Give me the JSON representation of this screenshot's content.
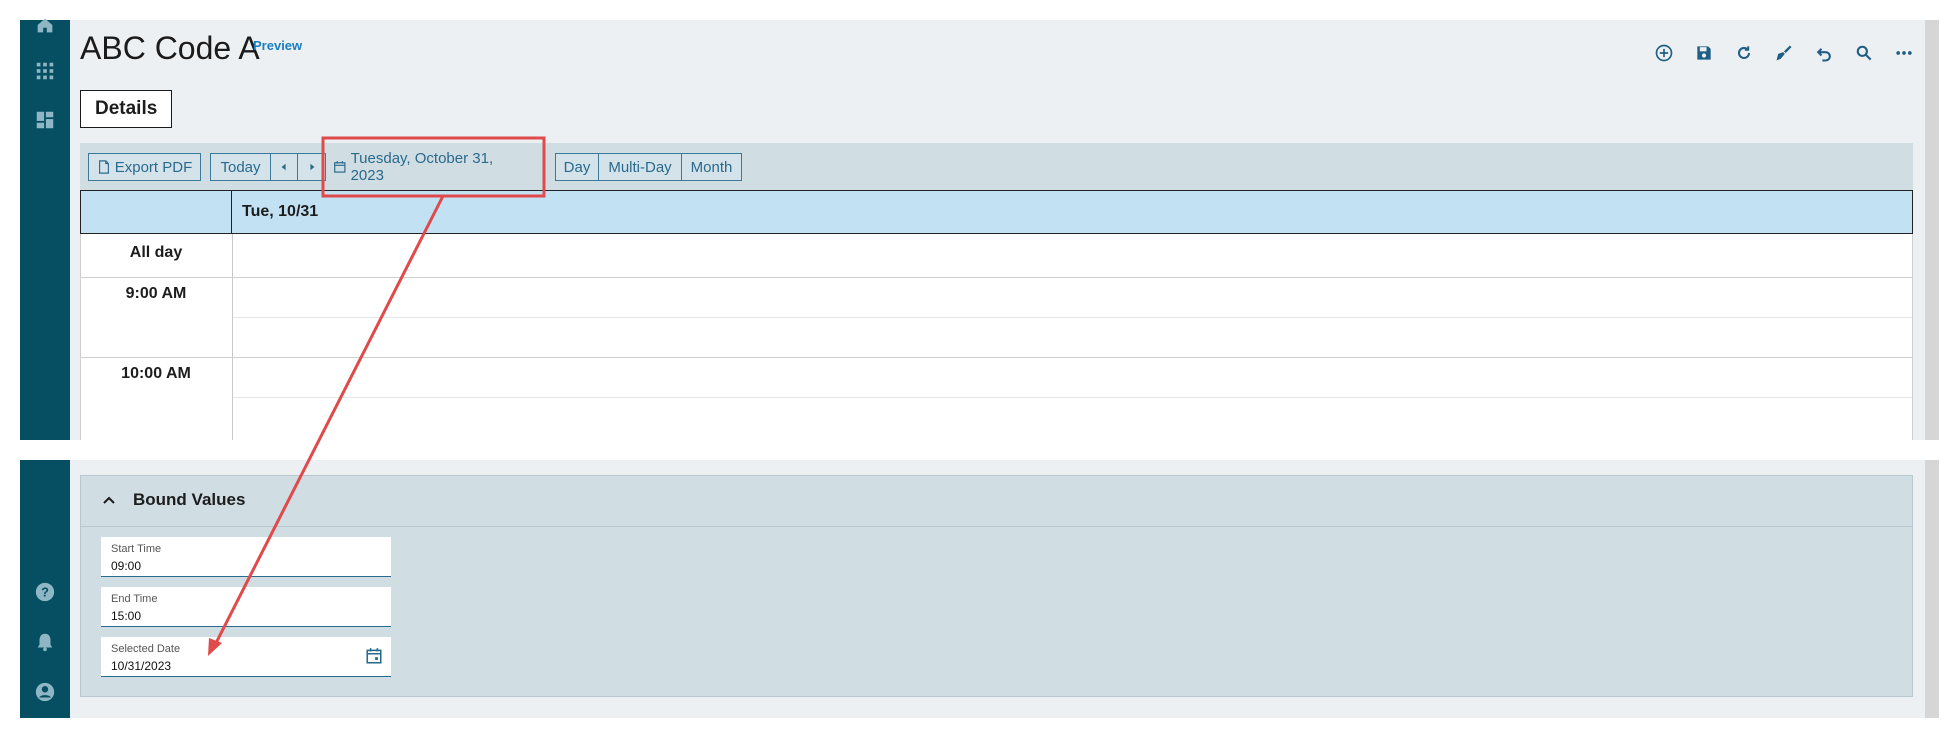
{
  "app": {
    "title": "ABC Code A",
    "badge": "Preview"
  },
  "tabs": {
    "details": "Details"
  },
  "toolbar": {
    "icons": [
      "add-icon",
      "save-icon",
      "refresh-icon",
      "clear-icon",
      "undo-icon",
      "search-icon",
      "more-icon"
    ]
  },
  "sidebar": {
    "icons": [
      "home-icon",
      "apps-icon",
      "dashboard-icon",
      "help-icon",
      "bell-icon",
      "user-icon"
    ]
  },
  "calendar": {
    "export_label": "Export PDF",
    "today_label": "Today",
    "date_label": "Tuesday, October 31, 2023",
    "views": [
      "Day",
      "Multi-Day",
      "Month"
    ],
    "day_header": "Tue, 10/31",
    "all_day": "All day",
    "times": [
      "9:00 AM",
      "10:00 AM"
    ]
  },
  "bound_values": {
    "title": "Bound Values",
    "fields": [
      {
        "label": "Start Time",
        "value": "09:00"
      },
      {
        "label": "End Time",
        "value": "15:00"
      },
      {
        "label": "Selected Date",
        "value": "10/31/2023"
      }
    ]
  },
  "colors": {
    "sidebar": "#064f63",
    "accent": "#2a6a8c",
    "highlight": "#e04a4a",
    "header": "#c2e2f4"
  }
}
